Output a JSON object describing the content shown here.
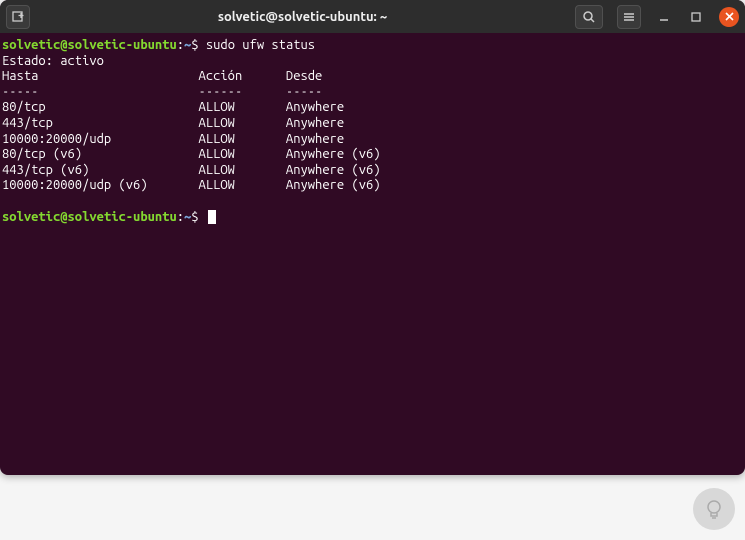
{
  "titlebar": {
    "title": "solvetic@solvetic-ubuntu: ~"
  },
  "prompt": {
    "user_host": "solvetic@solvetic-ubuntu",
    "separator": ":",
    "path": "~",
    "dollar": "$"
  },
  "command1": "sudo ufw status",
  "output": {
    "status_line": "Estado: activo",
    "blank1": "",
    "header_row": "Hasta                      Acción      Desde",
    "divider_row": "-----                      ------      -----",
    "rows": [
      "80/tcp                     ALLOW       Anywhere",
      "443/tcp                    ALLOW       Anywhere",
      "10000:20000/udp            ALLOW       Anywhere",
      "80/tcp (v6)                ALLOW       Anywhere (v6)",
      "443/tcp (v6)               ALLOW       Anywhere (v6)",
      "10000:20000/udp (v6)       ALLOW       Anywhere (v6)"
    ]
  },
  "table_data": {
    "columns": [
      "Hasta",
      "Acción",
      "Desde"
    ],
    "rules": [
      {
        "to": "80/tcp",
        "action": "ALLOW",
        "from": "Anywhere"
      },
      {
        "to": "443/tcp",
        "action": "ALLOW",
        "from": "Anywhere"
      },
      {
        "to": "10000:20000/udp",
        "action": "ALLOW",
        "from": "Anywhere"
      },
      {
        "to": "80/tcp (v6)",
        "action": "ALLOW",
        "from": "Anywhere (v6)"
      },
      {
        "to": "443/tcp (v6)",
        "action": "ALLOW",
        "from": "Anywhere (v6)"
      },
      {
        "to": "10000:20000/udp (v6)",
        "action": "ALLOW",
        "from": "Anywhere (v6)"
      }
    ]
  },
  "colors": {
    "bg": "#300a24",
    "titlebar": "#2d2d2d",
    "prompt_green": "#84d930",
    "prompt_blue": "#7aa6da",
    "close": "#e95420",
    "text": "#ffffff"
  }
}
